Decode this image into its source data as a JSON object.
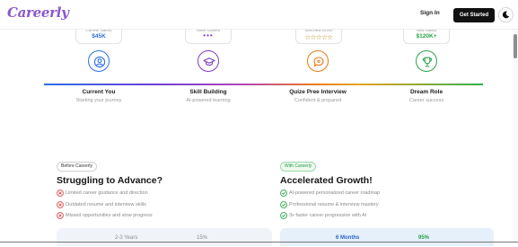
{
  "header": {
    "logo": "Careerly",
    "sign_in": "Sign In",
    "get_started": "Get Started"
  },
  "journey": {
    "steps": [
      {
        "title": "Current You",
        "subtitle": "Starting your journey",
        "stat_label": "Current Salary",
        "stat_value": "$45K",
        "color": "#2e6fe5"
      },
      {
        "title": "Skill Building",
        "subtitle": "AI-powered learning",
        "stat_label": "Skills Gained",
        "stat_value": "•••",
        "color": "#7a3cc7"
      },
      {
        "title": "Quize Pree Interview",
        "subtitle": "Confident & prepared",
        "stat_label": "Interview Score",
        "stat_value": "☆☆☆☆☆",
        "color": "#ea7a12"
      },
      {
        "title": "Dream Role",
        "subtitle": "Career success",
        "stat_label": "New Salary",
        "stat_value": "$120K+",
        "color": "#2aa449"
      }
    ],
    "icons": [
      "user-icon",
      "graduation-cap-icon",
      "chat-bubble-icon",
      "trophy-icon"
    ]
  },
  "comparison": {
    "before": {
      "badge": "Before Careerly",
      "title": "Struggling to Advance?",
      "items": [
        "Limited career guidance and direction",
        "Outdated resume and interview skills",
        "Missed opportunities and slow progress"
      ],
      "metric_time": "2-3 Years",
      "metric_pct": "15%"
    },
    "after": {
      "badge": "With Careerly",
      "title": "Accelerated Growth!",
      "items": [
        "AI-powered personalized career roadmap",
        "Professional resume & interview mastery",
        "3x faster career progression with AI"
      ],
      "metric_time": "6 Months",
      "metric_pct": "95%"
    }
  },
  "colors": {
    "brand": "#8a56cf",
    "negative": "#e04848",
    "positive": "#2aa449"
  }
}
